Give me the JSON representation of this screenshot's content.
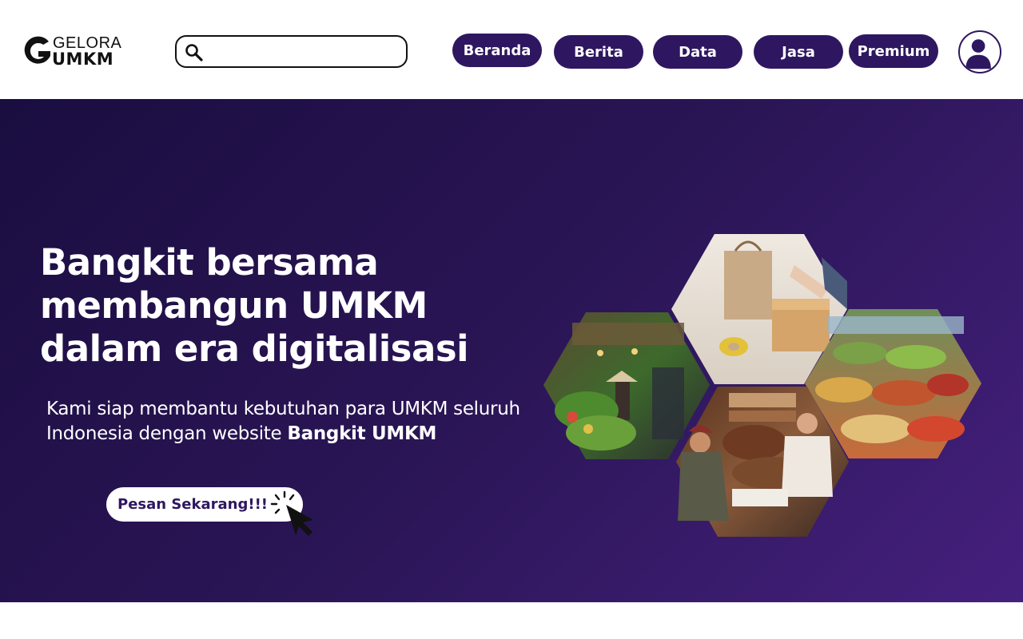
{
  "brand": {
    "line1": "GELORA",
    "line2": "UMKM"
  },
  "search": {
    "placeholder": "",
    "value": ""
  },
  "nav": [
    {
      "label": "Beranda"
    },
    {
      "label": "Berita"
    },
    {
      "label": "Data"
    },
    {
      "label": "Jasa"
    },
    {
      "label": "Premium"
    }
  ],
  "hero": {
    "title_lines": [
      "Bangkit bersama",
      "membangun UMKM",
      "dalam era digitalisasi"
    ],
    "desc_before": "Kami siap membantu kebutuhan para UMKM seluruh Indonesia dengan website ",
    "desc_bold": "Bangkit UMKM",
    "cta_label": "Pesan Sekarang!!!"
  },
  "colors": {
    "primary": "#2e1760",
    "hero_start": "#1a0d40",
    "hero_end": "#45207e",
    "white": "#ffffff"
  },
  "icons": [
    "gelora-g-logo-icon",
    "search-icon",
    "user-avatar-icon",
    "click-cursor-icon"
  ],
  "images": [
    "market-vegetables-photo",
    "packaging-box-photo",
    "fruit-market-photo",
    "dates-shop-photo"
  ]
}
